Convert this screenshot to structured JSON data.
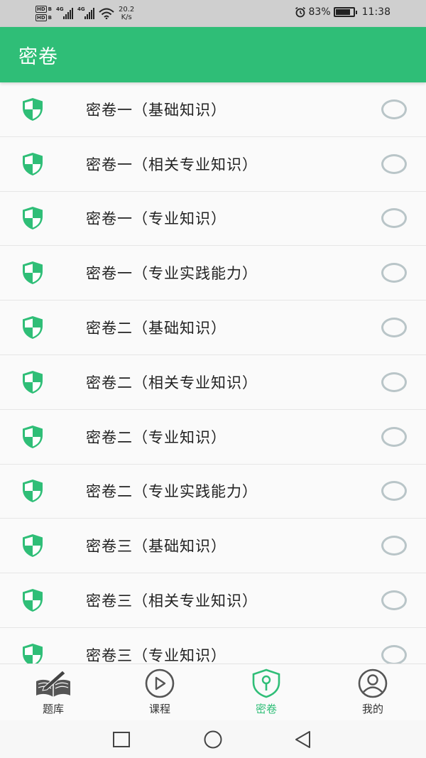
{
  "status_bar": {
    "hd_top": "HD",
    "hd_top_sub": "B",
    "hd_bottom": "HD",
    "hd_bottom_sub": "B",
    "signal_1_tag": "4G",
    "signal_2_tag": "4G",
    "net_speed_value": "20.2",
    "net_speed_unit": "K/s",
    "battery_percent": "83%",
    "battery_level": 0.83,
    "time": "11:38",
    "icons": [
      "signal-icon",
      "wifi-icon",
      "alarm-icon",
      "battery-icon"
    ]
  },
  "header": {
    "title": "密卷"
  },
  "list": {
    "items": [
      {
        "label": "密卷一（基础知识）",
        "selected": false
      },
      {
        "label": "密卷一（相关专业知识）",
        "selected": false
      },
      {
        "label": "密卷一（专业知识）",
        "selected": false
      },
      {
        "label": "密卷一（专业实践能力）",
        "selected": false
      },
      {
        "label": "密卷二（基础知识）",
        "selected": false
      },
      {
        "label": "密卷二（相关专业知识）",
        "selected": false
      },
      {
        "label": "密卷二（专业知识）",
        "selected": false
      },
      {
        "label": "密卷二（专业实践能力）",
        "selected": false
      },
      {
        "label": "密卷三（基础知识）",
        "selected": false
      },
      {
        "label": "密卷三（相关专业知识）",
        "selected": false
      },
      {
        "label": "密卷三（专业知识）",
        "selected": false
      }
    ],
    "item_icon": "shield-icon"
  },
  "bottom_nav": {
    "items": [
      {
        "label": "题库",
        "icon": "book-pen-icon",
        "active": false
      },
      {
        "label": "课程",
        "icon": "play-circle-icon",
        "active": false
      },
      {
        "label": "密卷",
        "icon": "shield-key-icon",
        "active": true
      },
      {
        "label": "我的",
        "icon": "user-circle-icon",
        "active": false
      }
    ]
  },
  "colors": {
    "accent": "#2fbe77",
    "radio_border": "#b9c5c8",
    "status_bar_bg": "#cfcfcf",
    "text_primary": "#222222",
    "nav_inactive": "#333333"
  }
}
